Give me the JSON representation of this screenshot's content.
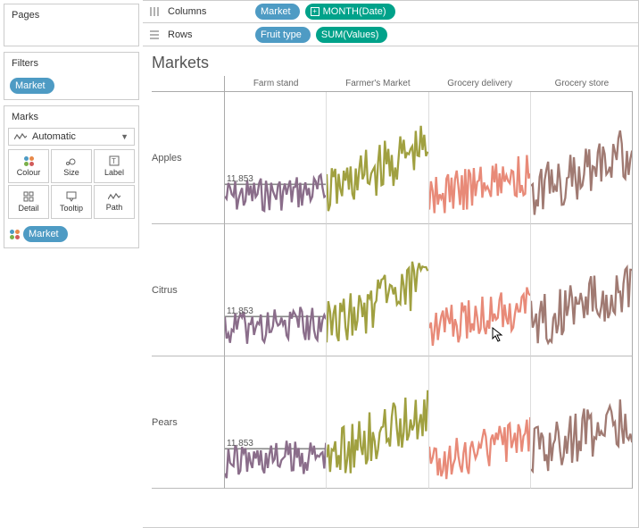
{
  "sidebar": {
    "pages_label": "Pages",
    "filters_label": "Filters",
    "filter_pill": "Market",
    "marks_label": "Marks",
    "marks_type": "Automatic",
    "buttons": {
      "colour": "Colour",
      "size": "Size",
      "label": "Label",
      "detail": "Detail",
      "tooltip": "Tooltip",
      "path": "Path"
    },
    "colour_pill": "Market"
  },
  "shelves": {
    "columns_label": "Columns",
    "columns_pills": [
      "Market",
      "MONTH(Date)"
    ],
    "rows_label": "Rows",
    "rows_pills": [
      "Fruit type",
      "SUM(Values)"
    ]
  },
  "viz": {
    "title": "Markets",
    "col_headers": [
      "Farm stand",
      "Farmer's Market",
      "Grocery delivery",
      "Grocery store"
    ],
    "row_headers": [
      "Apples",
      "Citrus",
      "Pears"
    ],
    "ref_label": "11,853"
  },
  "colors": {
    "farm_stand": "#8a6d8a",
    "farmers_market": "#a0a040",
    "grocery_delivery": "#e88a78",
    "grocery_store": "#a07a72"
  },
  "chart_data": {
    "type": "line",
    "note": "Small-multiples trellis: rows=fruit type, columns=market. X axis is monthly date index (60 points). Y axis is SUM(Values). Reference line at 11,853 shown in Farm stand column for each row.",
    "x_count": 60,
    "reference_line_value": 11853,
    "row_categories": [
      "Apples",
      "Citrus",
      "Pears"
    ],
    "col_categories": [
      "Farm stand",
      "Farmer's Market",
      "Grocery delivery",
      "Grocery store"
    ],
    "y_range_estimate": [
      0,
      40000
    ],
    "series_pattern": "All 12 panels show upward-trending noisy time series; Farm stand lowest amplitude (~5k-15k), Farmer's Market highest growth (~8k-38k), Grocery delivery moderate (~6k-25k), Grocery store high (~8k-35k)."
  }
}
